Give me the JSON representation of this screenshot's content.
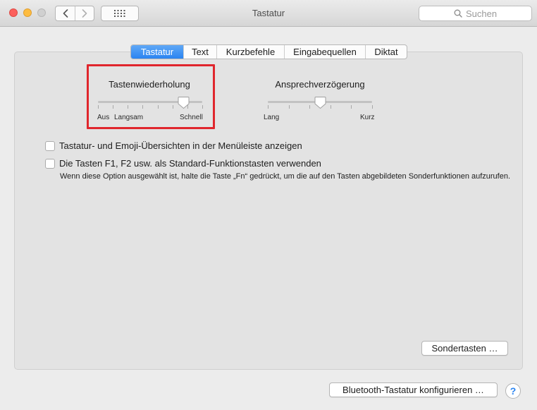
{
  "window": {
    "title": "Tastatur"
  },
  "search": {
    "placeholder": "Suchen"
  },
  "tabs": [
    {
      "label": "Tastatur",
      "active": true
    },
    {
      "label": "Text",
      "active": false
    },
    {
      "label": "Kurzbefehle",
      "active": false
    },
    {
      "label": "Eingabequellen",
      "active": false
    },
    {
      "label": "Diktat",
      "active": false
    }
  ],
  "key_repeat": {
    "title": "Tastenwiederholung",
    "label_off": "Aus",
    "label_slow": "Langsam",
    "label_fast": "Schnell",
    "value_fraction": 0.82
  },
  "delay_until_repeat": {
    "title": "Ansprechverzögerung",
    "label_long": "Lang",
    "label_short": "Kurz",
    "value_fraction": 0.5
  },
  "options": {
    "show_viewers_label": "Tastatur- und Emoji-Übersichten in der Menüleiste anzeigen",
    "show_viewers_checked": false,
    "fn_keys_label": "Die Tasten F1, F2 usw. als Standard-Funktionstasten verwenden",
    "fn_keys_checked": false,
    "fn_keys_note": "Wenn diese Option ausgewählt ist, halte die Taste „Fn“ gedrückt, um die auf den Tasten abgebildeten Sonderfunktionen aufzurufen."
  },
  "buttons": {
    "modifier_keys": "Sondertasten …",
    "bluetooth": "Bluetooth-Tastatur konfigurieren …",
    "help": "?"
  },
  "colors": {
    "accent": "#2a84f1",
    "highlight_frame": "#e0262d",
    "close": "#fc605c",
    "minimize": "#fdbc40"
  }
}
